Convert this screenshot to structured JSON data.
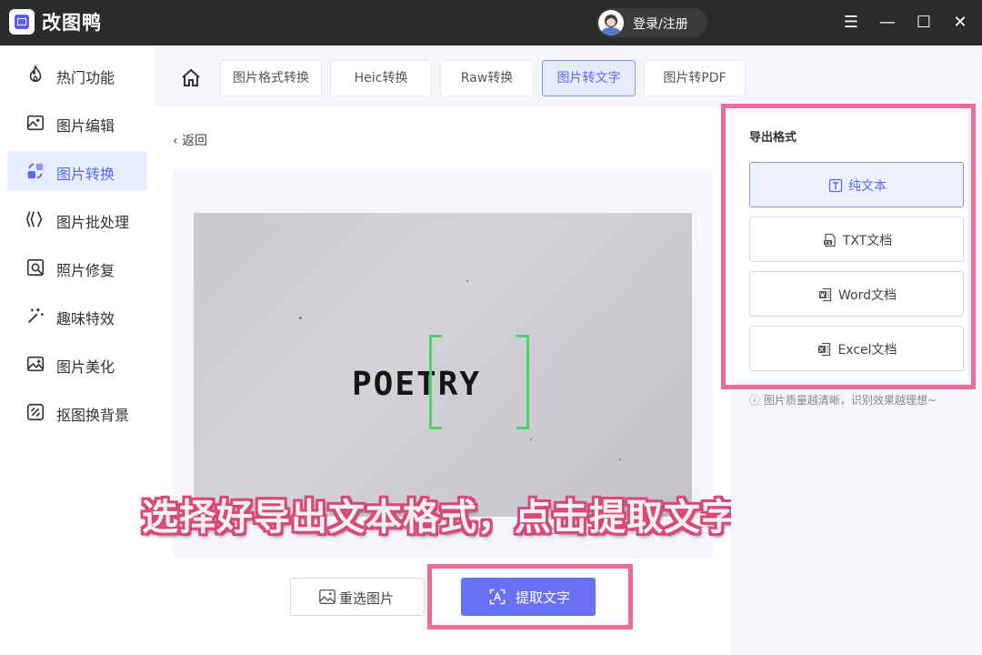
{
  "app": {
    "title": "改图鸭",
    "login_label": "登录/注册"
  },
  "window_controls": {
    "menu": "☰",
    "minimize": "—",
    "maximize": "☐",
    "close": "✕"
  },
  "sidebar": {
    "items": [
      {
        "label": "热门功能",
        "icon": "flame-icon"
      },
      {
        "label": "图片编辑",
        "icon": "image-edit-icon"
      },
      {
        "label": "图片转换",
        "icon": "convert-icon",
        "active": true
      },
      {
        "label": "图片批处理",
        "icon": "batch-icon"
      },
      {
        "label": "照片修复",
        "icon": "photo-repair-icon"
      },
      {
        "label": "趣味特效",
        "icon": "magic-wand-icon"
      },
      {
        "label": "图片美化",
        "icon": "image-beautify-icon"
      },
      {
        "label": "抠图换背景",
        "icon": "cutout-icon"
      }
    ]
  },
  "tabs": [
    {
      "label": "图片格式转换"
    },
    {
      "label": "Heic转换"
    },
    {
      "label": "Raw转换"
    },
    {
      "label": "图片转文字",
      "active": true
    },
    {
      "label": "图片转PDF"
    }
  ],
  "back_label": "返回",
  "preview": {
    "photo_text": "POETRY"
  },
  "subtitle": "选择好导出文本格式，点击提取文字即可",
  "buttons": {
    "reselect": "重选图片",
    "extract": "提取文字"
  },
  "export": {
    "title": "导出格式",
    "options": [
      {
        "label": "纯文本",
        "icon": "text-icon",
        "selected": true
      },
      {
        "label": "TXT文档",
        "icon": "txt-file-icon"
      },
      {
        "label": "Word文档",
        "icon": "word-file-icon"
      },
      {
        "label": "Excel文档",
        "icon": "excel-file-icon"
      }
    ],
    "hint": "图片质量越清晰，识别效果越理想~"
  },
  "colors": {
    "accent": "#6a70f3",
    "highlight": "#ef6a9a",
    "titlebar": "#2b2b2b"
  }
}
